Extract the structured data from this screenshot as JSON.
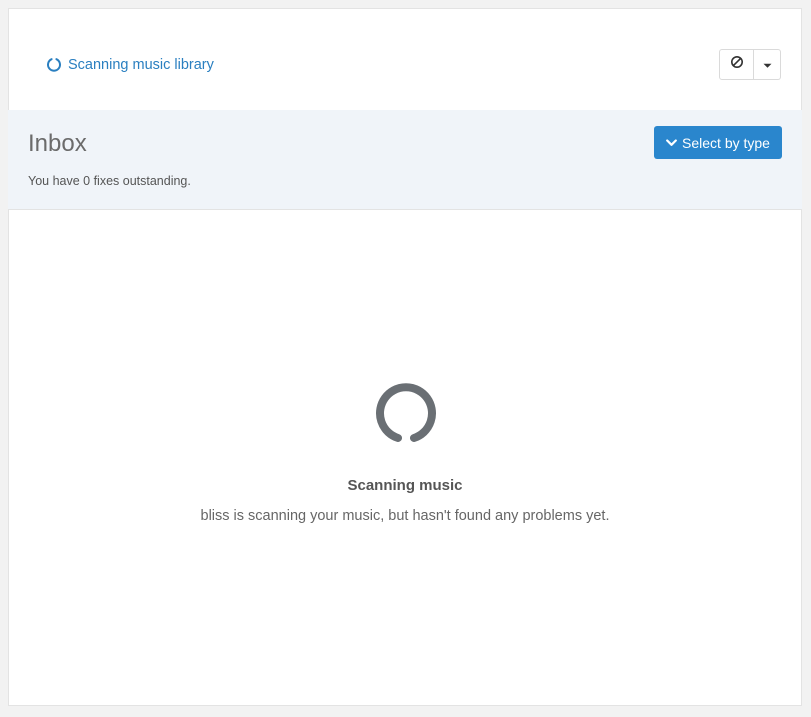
{
  "status": {
    "label": "Scanning music library",
    "icon": "spinner-icon",
    "color": "#2a7fc0"
  },
  "toolbar": {
    "cancel_icon": "ban-icon",
    "menu_icon": "caret-down-icon"
  },
  "inbox": {
    "title": "Inbox",
    "subtitle": "You have 0 fixes outstanding.",
    "select_button_label": "Select by type",
    "select_button_color": "#2a86cd"
  },
  "empty_state": {
    "icon": "spinner-icon",
    "title": "Scanning music",
    "description": "bliss is scanning your music, but hasn't found any problems yet."
  }
}
